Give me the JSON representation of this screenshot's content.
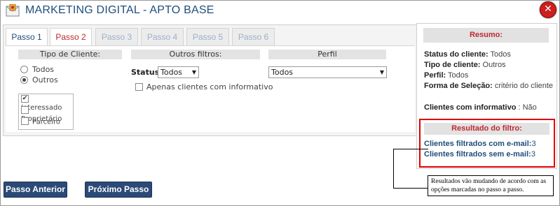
{
  "window": {
    "title": "MARKETING DIGITAL - APTO BASE",
    "close_icon": "close-icon",
    "title_icon": "mail-icon"
  },
  "tabs": [
    {
      "label": "Passo 1",
      "state": "visited"
    },
    {
      "label": "Passo 2",
      "state": "active"
    },
    {
      "label": "Passo 3",
      "state": "disabled"
    },
    {
      "label": "Passo 4",
      "state": "disabled"
    },
    {
      "label": "Passo 5",
      "state": "disabled"
    },
    {
      "label": "Passo 6",
      "state": "disabled"
    }
  ],
  "tipo_cliente": {
    "header": "Tipo de Cliente:",
    "radios": [
      {
        "label": "Todos",
        "checked": false
      },
      {
        "label": "Outros",
        "checked": true
      }
    ],
    "checkboxes": [
      {
        "label": "Interessado",
        "checked": true
      },
      {
        "label": "Proprietário",
        "checked": false
      },
      {
        "label": "Parceiro",
        "checked": false
      }
    ]
  },
  "outros_filtros": {
    "header": "Outros filtros:",
    "status_label": "Status",
    "status_value": "Todos",
    "informativo_label": "Apenas clientes com informativo",
    "informativo_checked": false
  },
  "perfil": {
    "header": "Perfil",
    "value": "Todos"
  },
  "buttons": {
    "anterior": "Passo Anterior",
    "proximo": "Próximo Passo"
  },
  "resumo": {
    "title": "Resumo:",
    "status_label": "Status do cliente:",
    "status_value": "Todos",
    "tipo_label": "Tipo de cliente:",
    "tipo_value": "Outros",
    "perfil_label": "Perfil:",
    "perfil_value": "Todos",
    "forma_label": "Forma de Seleção:",
    "forma_value": "critério do cliente",
    "informativo_label": "Clientes com informativo",
    "informativo_value": ": Não"
  },
  "resultado": {
    "title": "Resultado do filtro:",
    "com_email_label": "Clientes filtrados com e-mail:",
    "com_email_value": "3",
    "sem_email_label": "Clientes filtrados sem e-mail:",
    "sem_email_value": "3"
  },
  "note": "Resultados vão mudando de acordo com as opções marcadas no passo a passo.",
  "colors": {
    "accent_blue": "#1f4e79",
    "button_bg": "#2b4a77",
    "active_tab": "#c0272d",
    "highlight_border": "#e00000"
  }
}
